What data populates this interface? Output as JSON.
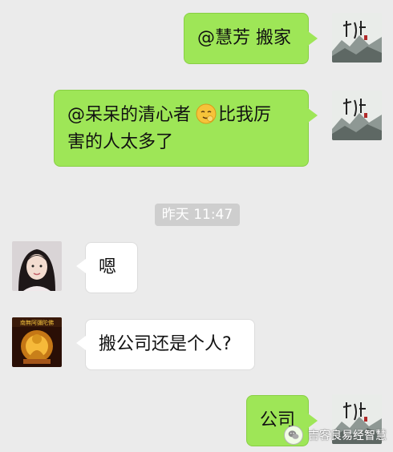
{
  "messages": [
    {
      "sender": "self",
      "text": "@慧芳 搬家",
      "avatar": "ink-landscape-calligraphy-avatar"
    },
    {
      "sender": "self",
      "text_before_emoji": "@呆呆的清心者",
      "emoji": "embarrassed-emoji",
      "text_after_emoji": "比我厉",
      "text_line2": "害的人太多了",
      "avatar": "ink-landscape-calligraphy-avatar"
    },
    {
      "sender": "other",
      "text": "嗯",
      "avatar": "woman-portrait-avatar"
    },
    {
      "sender": "other",
      "text": "搬公司还是个人?",
      "avatar": "buddha-avatar"
    },
    {
      "sender": "self",
      "text": "公司",
      "avatar": "ink-landscape-calligraphy-avatar"
    }
  ],
  "timestamp": "昨天 11:47",
  "watermark": "吉客良易经智慧",
  "colors": {
    "background": "#ebebeb",
    "self_bubble": "#9ee657",
    "other_bubble": "#ffffff",
    "timestamp_bg": "#cecece"
  }
}
